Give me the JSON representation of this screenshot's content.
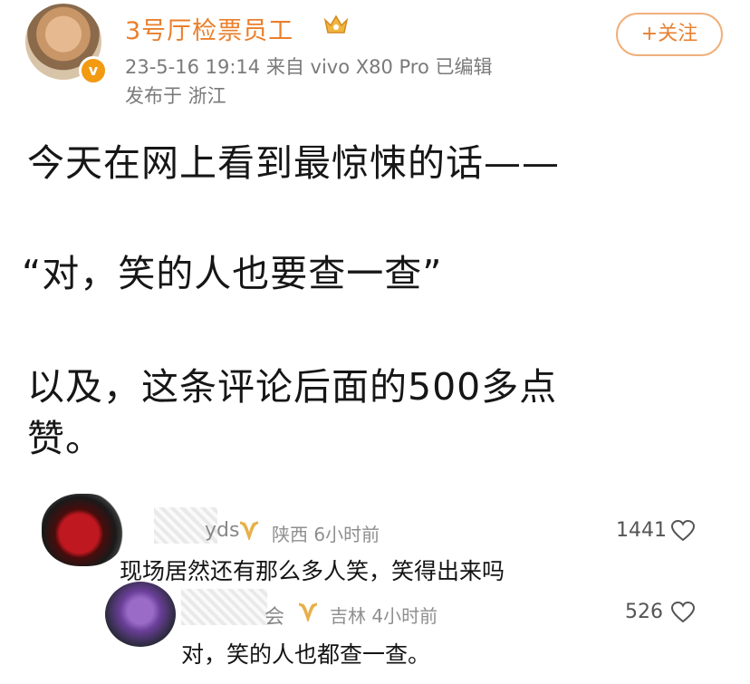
{
  "post": {
    "username": "3号厅检票员工",
    "timestamp": "23-5-16 19:14",
    "source": "来自 vivo X80 Pro",
    "edited": "已编辑",
    "location": "发布于 浙江",
    "follow_label": "+关注",
    "lines": [
      "今天在网上看到最惊悚的话——",
      "“对，笑的人也要查一查”",
      "以及，这条评论后面的500多点",
      "赞。"
    ]
  },
  "comments": [
    {
      "name_visible": "yds",
      "region_time": "陕西 6小时前",
      "likes": "1441",
      "text": "现场居然还有那么多人笑，笑得出来吗"
    },
    {
      "name_visible": "会",
      "region_time": "吉林 4小时前",
      "likes": "526",
      "text": "对，笑的人也都查一查。"
    }
  ],
  "colors": {
    "username": "#ea7f2c",
    "follow": "#e8802f",
    "verify_badge": "#f29a12",
    "vip_badge": "#e8b04a",
    "meta": "#7a7a7a"
  },
  "icons": [
    "crown-icon",
    "verified-badge-icon",
    "vip-badge-icon",
    "heart-icon"
  ]
}
